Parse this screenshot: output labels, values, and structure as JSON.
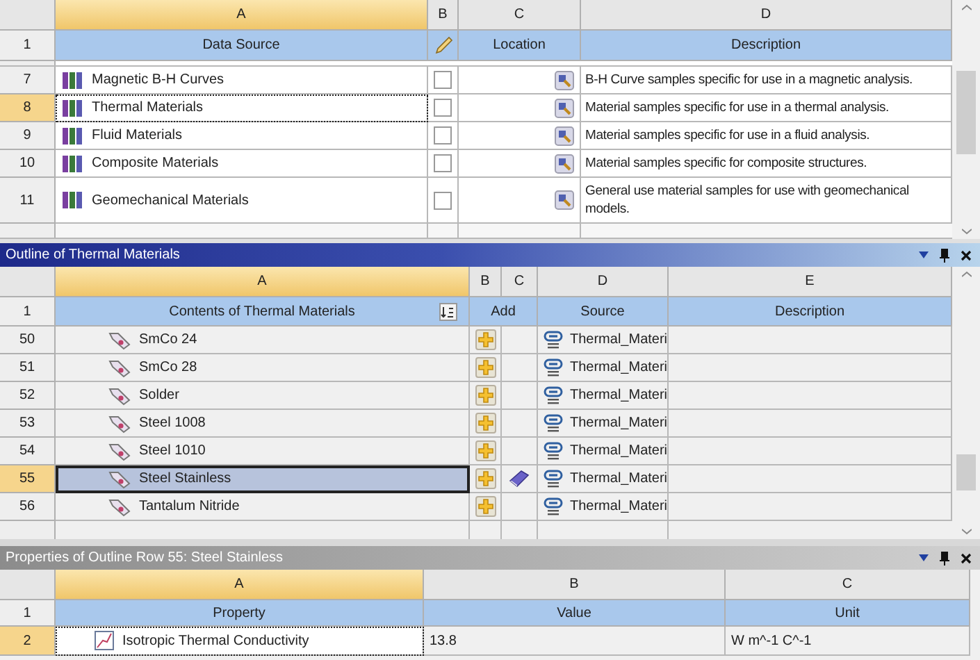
{
  "data_sources": {
    "columns": [
      {
        "letter": "A",
        "heading": "Data Source"
      },
      {
        "letter": "B"
      },
      {
        "letter": "C",
        "heading": "Location"
      },
      {
        "letter": "D",
        "heading": "Description"
      }
    ],
    "heading_row": "1",
    "rows": [
      {
        "number": "7",
        "name": "Magnetic B-H Curves",
        "checked": false,
        "selected": false,
        "description": "B-H Curve samples specific for use in a magnetic analysis."
      },
      {
        "number": "8",
        "name": "Thermal Materials",
        "checked": false,
        "selected": true,
        "description": "Material samples specific for use in a thermal analysis."
      },
      {
        "number": "9",
        "name": "Fluid Materials",
        "checked": false,
        "selected": false,
        "description": "Material samples specific for use in a fluid analysis."
      },
      {
        "number": "10",
        "name": "Composite Materials",
        "checked": false,
        "selected": false,
        "description": "Material samples specific for composite structures."
      },
      {
        "number": "11",
        "name": "Geomechanical Materials",
        "checked": false,
        "selected": false,
        "description": "General use material samples for use with geomechanical models."
      }
    ]
  },
  "outline": {
    "title": "Outline of Thermal Materials",
    "active": true,
    "columns": [
      {
        "letter": "A",
        "heading": "Contents of Thermal Materials"
      },
      {
        "letter": "B",
        "heading": "Add"
      },
      {
        "letter": "C"
      },
      {
        "letter": "D",
        "heading": "Source"
      },
      {
        "letter": "E",
        "heading": "Description"
      }
    ],
    "heading_row": "1",
    "rows": [
      {
        "number": "50",
        "name": "SmCo 24",
        "in_project": false,
        "selected": false,
        "source": "Thermal_Materi"
      },
      {
        "number": "51",
        "name": "SmCo 28",
        "in_project": false,
        "selected": false,
        "source": "Thermal_Materi"
      },
      {
        "number": "52",
        "name": "Solder",
        "in_project": false,
        "selected": false,
        "source": "Thermal_Materi"
      },
      {
        "number": "53",
        "name": "Steel 1008",
        "in_project": false,
        "selected": false,
        "source": "Thermal_Materi"
      },
      {
        "number": "54",
        "name": "Steel 1010",
        "in_project": false,
        "selected": false,
        "source": "Thermal_Materi"
      },
      {
        "number": "55",
        "name": "Steel Stainless",
        "in_project": true,
        "selected": true,
        "source": "Thermal_Materi"
      },
      {
        "number": "56",
        "name": "Tantalum Nitride",
        "in_project": false,
        "selected": false,
        "source": "Thermal_Materi"
      }
    ]
  },
  "properties": {
    "title": "Properties of Outline Row 55: Steel Stainless",
    "active": false,
    "columns": [
      {
        "letter": "A",
        "heading": "Property"
      },
      {
        "letter": "B",
        "heading": "Value"
      },
      {
        "letter": "C",
        "heading": "Unit"
      }
    ],
    "heading_row": "1",
    "rows": [
      {
        "number": "2",
        "property": "Isotropic Thermal Conductivity",
        "value": "13.8",
        "unit": "W m^-1 C^-1",
        "selected": true
      }
    ]
  }
}
